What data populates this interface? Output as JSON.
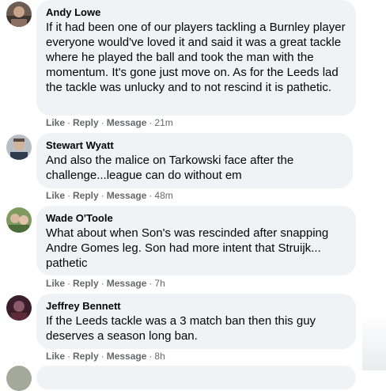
{
  "comments": [
    {
      "author": "Andy Lowe",
      "text": "If it had been one of our players tackling a Burnley player everyone would've loved it and said it was a great tackle where he played the ball and took the man with the momentum. It's gone just move on. As for the Leeds lad the tackle was unlucky and to not rescind it is pathetic.",
      "like": "Like",
      "reply": "Reply",
      "message": "Message",
      "time": "21m"
    },
    {
      "author": "Stewart Wyatt",
      "text": "And also the malice on Tarkowski face after the challenge...league can do without em",
      "like": "Like",
      "reply": "Reply",
      "message": "Message",
      "time": "48m"
    },
    {
      "author": "Wade O'Toole",
      "text": "What about when Son's was rescinded after snapping Andre Gomes leg. Son had more intent that Struijk... pathetic",
      "like": "Like",
      "reply": "Reply",
      "message": "Message",
      "time": "7h"
    },
    {
      "author": "Jeffrey Bennett",
      "text": "If the Leeds tackle was a 3 match ban then this guy deserves a season long ban.",
      "like": "Like",
      "reply": "Reply",
      "message": "Message",
      "time": "8h"
    }
  ],
  "separator": "·"
}
